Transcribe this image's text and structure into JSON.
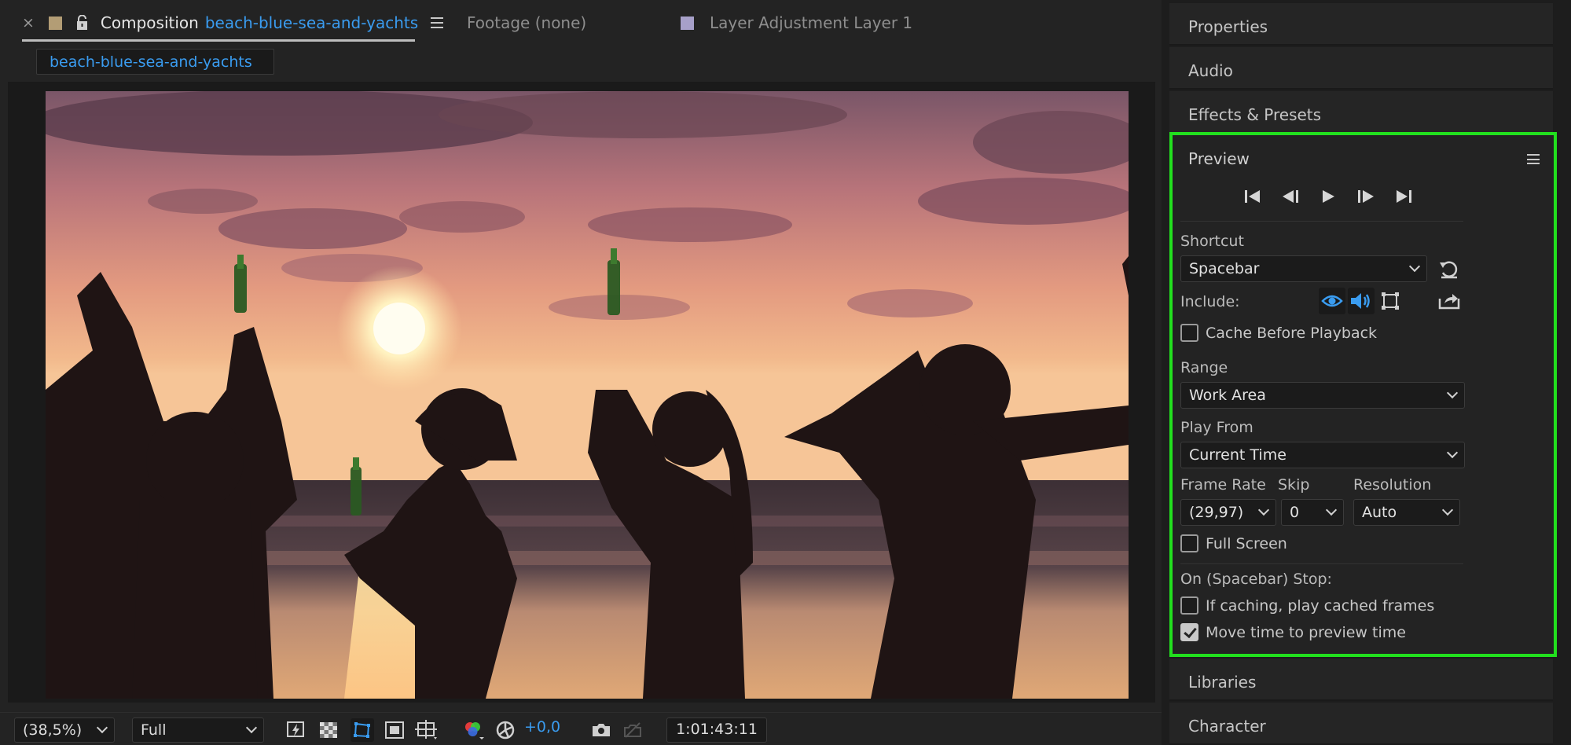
{
  "composition_tabs": {
    "close_glyph": "×",
    "composition_prefix": "Composition",
    "composition_name": "beach-blue-sea-and-yachts",
    "footage_tab": "Footage (none)",
    "layer_tab": "Layer Adjustment Layer 1"
  },
  "breadcrumb": "beach-blue-sea-and-yachts",
  "viewer_bar": {
    "zoom": "(38,5%)",
    "resolution": "Full",
    "exposure": "+0,0",
    "timecode": "1:01:43:11"
  },
  "dock": {
    "properties": "Properties",
    "audio": "Audio",
    "effects_presets": "Effects & Presets",
    "libraries": "Libraries",
    "character": "Character"
  },
  "preview": {
    "title": "Preview",
    "shortcut_label": "Shortcut",
    "shortcut_value": "Spacebar",
    "include_label": "Include:",
    "cache_before_playback": "Cache Before Playback",
    "range_label": "Range",
    "range_value": "Work Area",
    "play_from_label": "Play From",
    "play_from_value": "Current Time",
    "frame_rate_label": "Frame Rate",
    "frame_rate_value": "(29,97)",
    "skip_label": "Skip",
    "skip_value": "0",
    "resolution_label": "Resolution",
    "resolution_value": "Auto",
    "full_screen": "Full Screen",
    "on_stop_label": "On (Spacebar) Stop:",
    "if_caching": "If caching, play cached frames",
    "move_time": "Move time to preview time",
    "cache_before_playback_checked": false,
    "full_screen_checked": false,
    "if_caching_checked": false,
    "move_time_checked": true
  },
  "colors": {
    "accent_blue": "#3a9cf0",
    "highlight_green": "#22e01e",
    "composition_swatch": "#b39d75",
    "layer_swatch": "#a7a0c9"
  }
}
